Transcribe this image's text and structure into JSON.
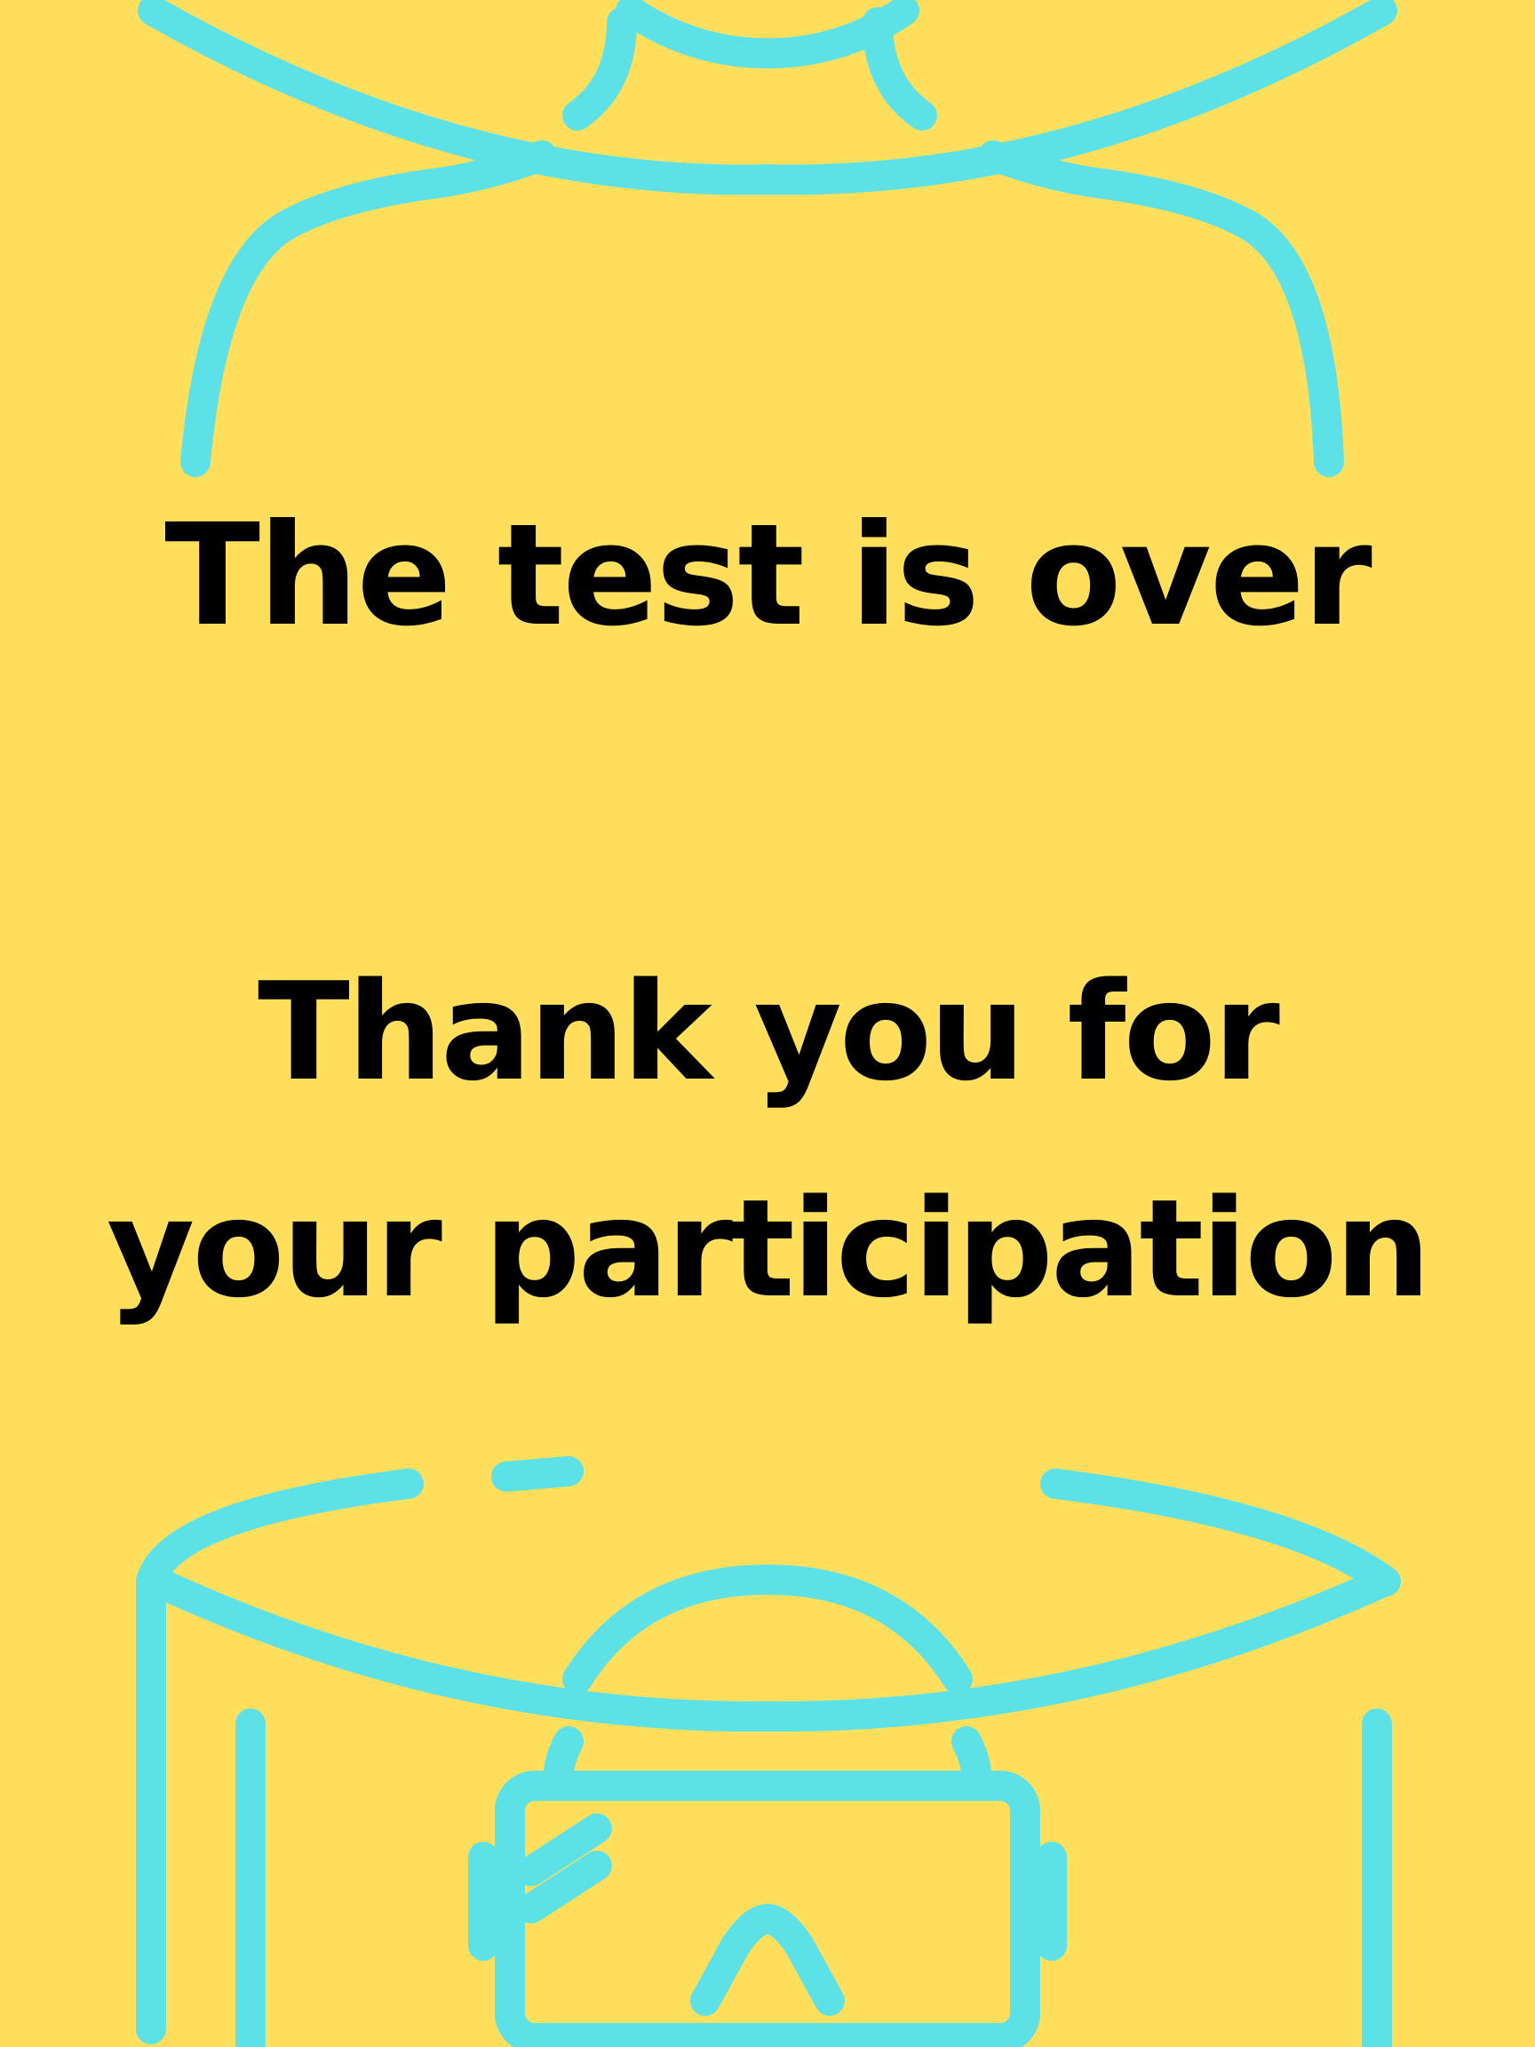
{
  "screen": {
    "background_color": "#FFDF5C",
    "accent_color": "#5CE1E6",
    "text_color": "#000000"
  },
  "message": {
    "title": "The test is over",
    "thanks_line_1": "Thank you for",
    "thanks_line_2": "your participation"
  },
  "icons": {
    "top": "vr-headset-icon",
    "bottom": "vr-headset-icon"
  }
}
